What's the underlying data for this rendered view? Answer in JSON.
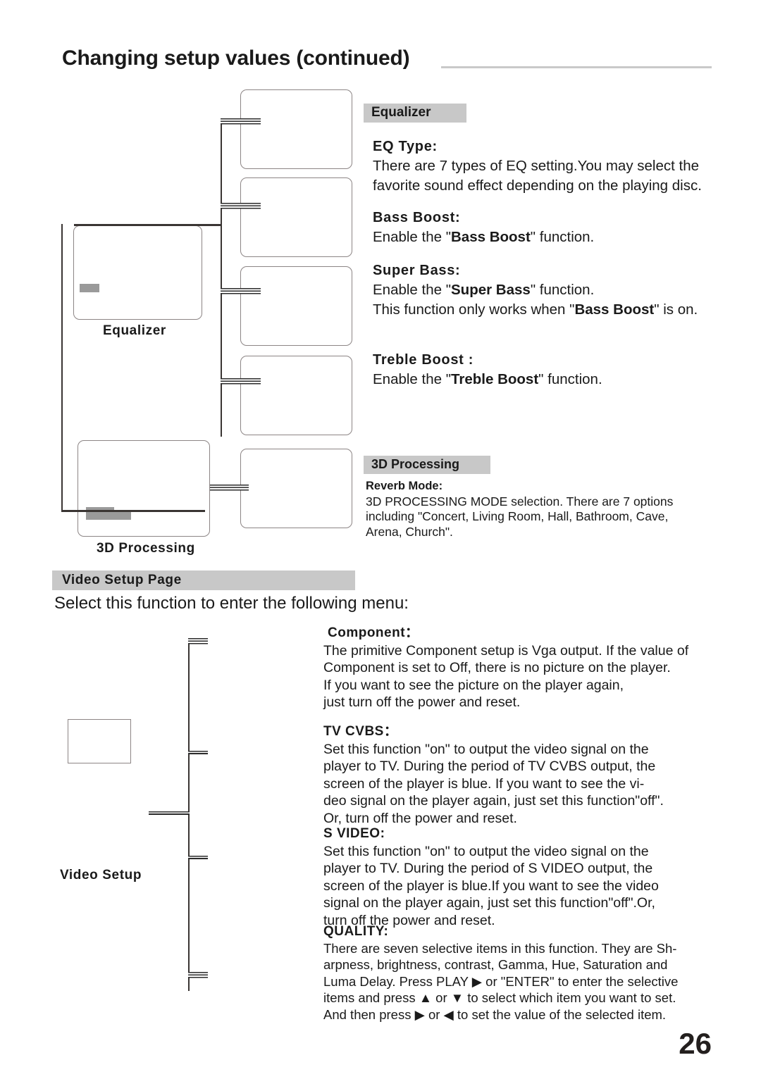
{
  "header": {
    "title": "Changing setup values (continued)"
  },
  "diagram_top": {
    "label_equalizer": "Equalizer",
    "label_3d_processing": "3D Processing"
  },
  "equalizer": {
    "section_heading": "Equalizer",
    "items": [
      {
        "name": "EQ Type:",
        "lines": [
          "There are 7 types of EQ setting.You may select the",
          "favorite sound effect depending on the playing disc."
        ]
      },
      {
        "name": "Bass  Boost:",
        "lines": [
          "Enable the \"Bass Boost\" function."
        ]
      },
      {
        "name": "Super  Bass:",
        "lines": [
          "Enable the \"Super Bass\" function.",
          "This function only works when \"Bass Boost\" is on."
        ]
      },
      {
        "name": "Treble  Boost :",
        "lines": [
          "Enable the \"Treble Boost\" function."
        ]
      }
    ]
  },
  "processing3d": {
    "section_heading": "3D Processing",
    "item_name": "Reverb Mode:",
    "lines": [
      "3D PROCESSING MODE selection. There are 7 options",
      "including \"Concert, Living Room, Hall, Bathroom, Cave,",
      "Arena, Church\"."
    ]
  },
  "video_setup": {
    "section_heading": "Video Setup Page",
    "intro": "Select this function to enter the  following menu:",
    "diagram_label": "Video Setup",
    "items": [
      {
        "name": "Component：",
        "lines": [
          "The primitive Component setup is Vga output. If the value of",
          "Component is set to Off, there is no picture on the player.",
          " If you want to see the picture on the player again,",
          "just turn off the power and reset."
        ]
      },
      {
        "name": "TV CVBS：",
        "lines": [
          "Set this function \"on\" to output the video signal on  the",
          "player to TV. During the period of TV CVBS output, the",
          "screen of  the player is blue.  If you want to see the vi-",
          "deo signal on the player again, just set this function\"off\".",
          "Or, turn off the power and reset."
        ]
      },
      {
        "name": "S VIDEO:",
        "lines": [
          "Set this function \"on\" to output the video signal on  the",
          "player to TV. During the period of S VIDEO output, the",
          "screen of  the player is blue.If you want to see the video",
          "signal on the player again, just set this function\"off\".Or,",
          "turn off the power and reset."
        ]
      },
      {
        "name": "QUALITY:",
        "lines": [
          "There are seven selective items in this function. They are Sh-",
          "arpness, brightness, contrast, Gamma, Hue, Saturation and",
          "Luma Delay. Press PLAY ▶ or \"ENTER\" to enter the selective",
          " items and press ▲ or ▼ to select which item you want to set.",
          "And then press ▶ or ◀ to set the value of the selected item."
        ]
      }
    ]
  },
  "footer": {
    "page_number": "26"
  },
  "colors": {
    "section_heading_bg": "#c8c8c8",
    "box_border": "#8c8585",
    "highlight_bar": "#9a9a9a",
    "rule": "#c9c9c9",
    "text": "#1a1a1a"
  }
}
